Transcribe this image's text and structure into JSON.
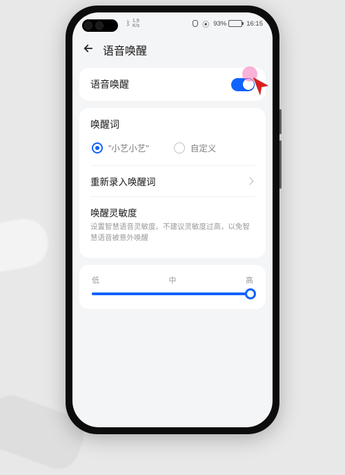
{
  "status_bar": {
    "bt_label": "1.9",
    "kbs_label": "K/s",
    "mic_label": "",
    "battery_pct": "93%",
    "time": "16:15"
  },
  "header": {
    "title": "语音唤醒"
  },
  "toggle_section": {
    "label": "语音唤醒",
    "enabled": true
  },
  "wakeword_section": {
    "title": "唤醒词",
    "options": [
      {
        "label": "\"小艺小艺\"",
        "selected": true
      },
      {
        "label": "自定义",
        "selected": false
      }
    ],
    "rerecord_label": "重新录入唤醒词"
  },
  "sensitivity_section": {
    "title": "唤醒灵敏度",
    "description": "设置智慧语音灵敏度。不建议灵敏度过高，以免智慧语音被意外唤醒"
  },
  "slider": {
    "low": "低",
    "mid": "中",
    "high": "高",
    "value_pct": 100
  },
  "colors": {
    "accent": "#1062ff"
  }
}
